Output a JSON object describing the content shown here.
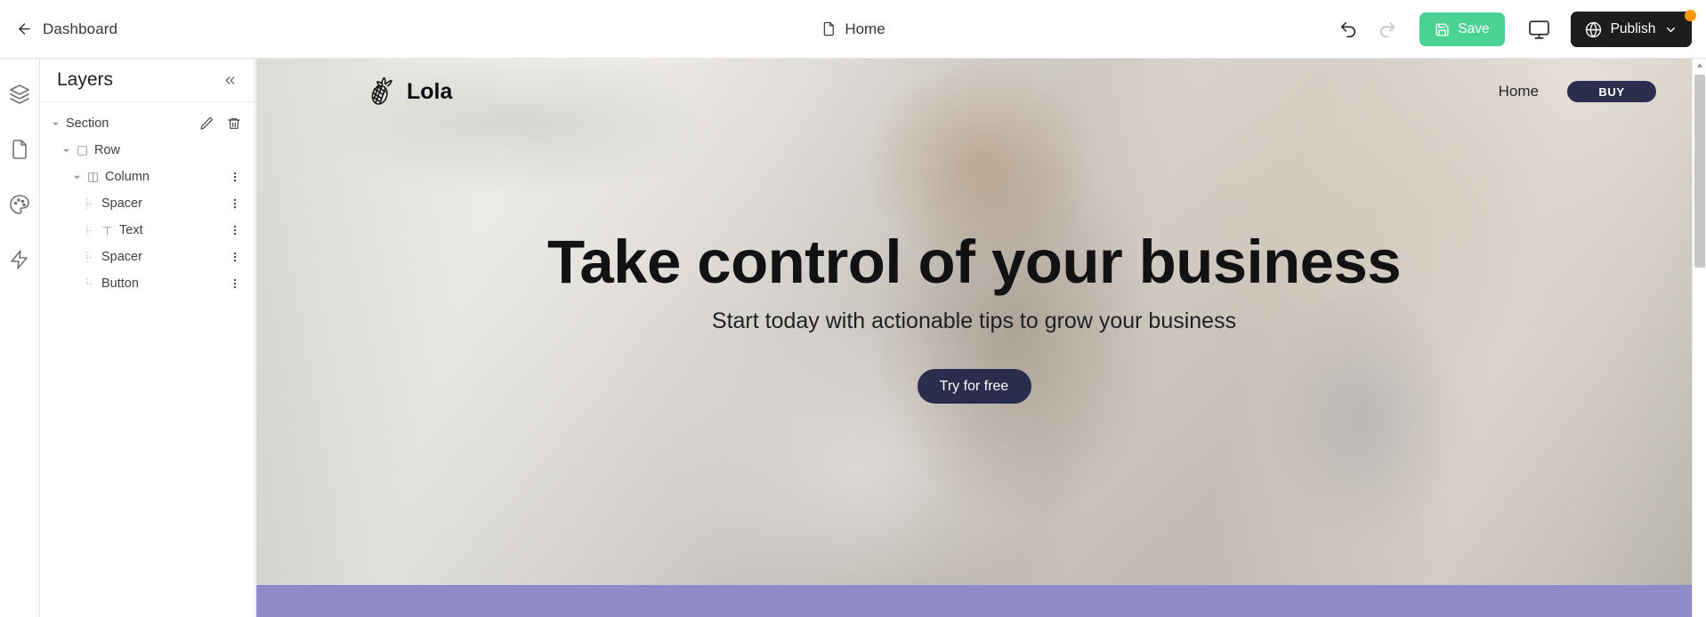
{
  "topbar": {
    "back_label": "Dashboard",
    "back_icon": "arrow-left-icon",
    "page_icon": "file-icon",
    "page_title": "Home",
    "undo_icon": "undo-icon",
    "redo_icon": "redo-icon",
    "save_label": "Save",
    "save_icon": "floppy-disk-icon",
    "save_color": "#4ad294",
    "preview_icon": "monitor-icon",
    "publish_label": "Publish",
    "publish_icon": "globe-icon",
    "publish_chevron": "chevron-down-icon",
    "publish_color": "#1d1d1f",
    "notification_color": "#ff9800"
  },
  "rail": {
    "items": [
      {
        "icon": "layers-icon",
        "name": "layers"
      },
      {
        "icon": "page-icon",
        "name": "pages"
      },
      {
        "icon": "palette-icon",
        "name": "theme"
      },
      {
        "icon": "bolt-icon",
        "name": "effects"
      }
    ]
  },
  "panel": {
    "title": "Layers",
    "collapse_icon": "chevrons-left-icon",
    "tree": [
      {
        "label": "Section",
        "depth": 0,
        "caret": true,
        "icon": null,
        "tail": false,
        "actions": "edit-delete"
      },
      {
        "label": "Row",
        "depth": 1,
        "caret": true,
        "icon": "square-icon",
        "tail": false,
        "actions": "none"
      },
      {
        "label": "Column",
        "depth": 2,
        "caret": true,
        "icon": "columns-icon",
        "tail": false,
        "actions": "kebab"
      },
      {
        "label": "Spacer",
        "depth": 3,
        "caret": false,
        "icon": null,
        "tail": true,
        "actions": "kebab"
      },
      {
        "label": "Text",
        "depth": 3,
        "caret": false,
        "icon": "text-icon",
        "tail": true,
        "actions": "kebab"
      },
      {
        "label": "Spacer",
        "depth": 3,
        "caret": false,
        "icon": null,
        "tail": true,
        "actions": "kebab"
      },
      {
        "label": "Button",
        "depth": 3,
        "caret": false,
        "icon": null,
        "tail": true,
        "actions": "kebab"
      }
    ],
    "edit_icon": "pencil-icon",
    "delete_icon": "trash-icon",
    "kebab_icon": "kebab-menu-icon"
  },
  "canvas": {
    "brand_name": "Lola",
    "brand_icon": "pineapple-icon",
    "nav_links": [
      "Home"
    ],
    "buy_label": "BUY",
    "buy_color": "#2b2d4f",
    "hero_title": "Take control of your business",
    "hero_subtitle": "Start today with actionable tips to grow your business",
    "cta_label": "Try for free",
    "cta_color": "#2b2d4f",
    "band_color": "#8f8bc9"
  },
  "scrollbar": {
    "up_icon": "caret-up-icon"
  }
}
